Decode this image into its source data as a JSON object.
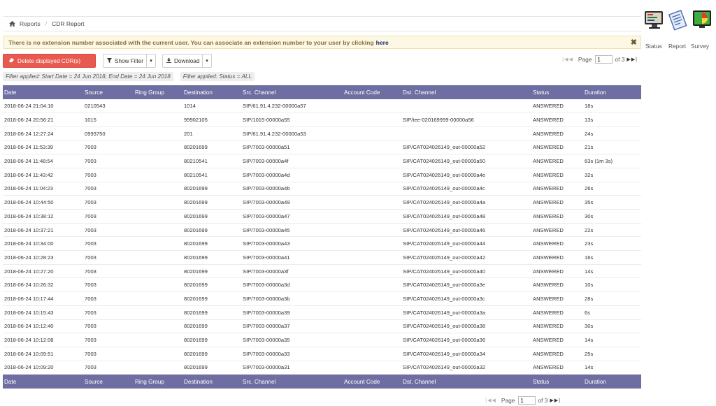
{
  "breadcrumb": {
    "items": [
      "Reports",
      "CDR Report"
    ]
  },
  "alert": {
    "message": "There is no extension number associated with the current user. You can associate an extension number to your user by clicking",
    "link": "here",
    "close": "✖"
  },
  "toolbar": {
    "delete_label": "Delete displayed CDR(s)",
    "filter_label": "Show Filter",
    "download_label": "Download"
  },
  "pagination": {
    "label": "Page",
    "current": "1",
    "of_label": "of 3"
  },
  "filters": [
    "Filter applied: Start Date = 24 Jun 2018, End Date = 24 Jun 2018",
    "Filter applied: Status = ALL"
  ],
  "table": {
    "columns": [
      "Date",
      "Source",
      "Ring Group",
      "Destination",
      "Src. Channel",
      "Account Code",
      "Dst. Channel",
      "Status",
      "Duration"
    ],
    "rows": [
      [
        "2018-06-24 21:04:10",
        "0210543",
        "",
        "1014",
        "SIP/61.91.4.232-00000a57",
        "",
        "",
        "ANSWERED",
        "18s"
      ],
      [
        "2018-06-24 20:56:21",
        "1015",
        "",
        "99902105",
        "SIP/1015-00000a55",
        "",
        "SIP/tee-020169999-00000a56",
        "ANSWERED",
        "13s"
      ],
      [
        "2018-06-24 12:27:24",
        "0993750",
        "",
        "201",
        "SIP/61.91.4.232-00000a53",
        "",
        "",
        "ANSWERED",
        "24s"
      ],
      [
        "2018-06-24 11:53:39",
        "7003",
        "",
        "80201699",
        "SIP/7003-00000a51",
        "",
        "SIP/CAT024026149_out-00000a52",
        "ANSWERED",
        "21s"
      ],
      [
        "2018-06-24 11:48:54",
        "7003",
        "",
        "80210541",
        "SIP/7003-00000a4f",
        "",
        "SIP/CAT024026149_out-00000a50",
        "ANSWERED",
        "63s (1m 3s)"
      ],
      [
        "2018-06-24 11:43:42",
        "7003",
        "",
        "80210541",
        "SIP/7003-00000a4d",
        "",
        "SIP/CAT024026149_out-00000a4e",
        "ANSWERED",
        "32s"
      ],
      [
        "2018-06-24 11:04:23",
        "7003",
        "",
        "80201699",
        "SIP/7003-00000a4b",
        "",
        "SIP/CAT024026149_out-00000a4c",
        "ANSWERED",
        "26s"
      ],
      [
        "2018-06-24 10:44:50",
        "7003",
        "",
        "80201699",
        "SIP/7003-00000a49",
        "",
        "SIP/CAT024026149_out-00000a4a",
        "ANSWERED",
        "35s"
      ],
      [
        "2018-06-24 10:38:12",
        "7003",
        "",
        "80201699",
        "SIP/7003-00000a47",
        "",
        "SIP/CAT024026149_out-00000a48",
        "ANSWERED",
        "30s"
      ],
      [
        "2018-06-24 10:37:21",
        "7003",
        "",
        "80201699",
        "SIP/7003-00000a45",
        "",
        "SIP/CAT024026149_out-00000a46",
        "ANSWERED",
        "22s"
      ],
      [
        "2018-06-24 10:34:00",
        "7003",
        "",
        "80201699",
        "SIP/7003-00000a43",
        "",
        "SIP/CAT024026149_out-00000a44",
        "ANSWERED",
        "23s"
      ],
      [
        "2018-06-24 10:28:23",
        "7003",
        "",
        "80201699",
        "SIP/7003-00000a41",
        "",
        "SIP/CAT024026149_out-00000a42",
        "ANSWERED",
        "16s"
      ],
      [
        "2018-06-24 10:27:20",
        "7003",
        "",
        "80201699",
        "SIP/7003-00000a3f",
        "",
        "SIP/CAT024026149_out-00000a40",
        "ANSWERED",
        "14s"
      ],
      [
        "2018-06-24 10:26:32",
        "7003",
        "",
        "80201699",
        "SIP/7003-00000a3d",
        "",
        "SIP/CAT024026149_out-00000a3e",
        "ANSWERED",
        "10s"
      ],
      [
        "2018-06-24 10:17:44",
        "7003",
        "",
        "80201699",
        "SIP/7003-00000a3b",
        "",
        "SIP/CAT024026149_out-00000a3c",
        "ANSWERED",
        "28s"
      ],
      [
        "2018-06-24 10:15:43",
        "7003",
        "",
        "80201699",
        "SIP/7003-00000a39",
        "",
        "SIP/CAT024026149_out-00000a3a",
        "ANSWERED",
        "6s"
      ],
      [
        "2018-06-24 10:12:40",
        "7003",
        "",
        "80201699",
        "SIP/7003-00000a37",
        "",
        "SIP/CAT024026149_out-00000a38",
        "ANSWERED",
        "30s"
      ],
      [
        "2018-06-24 10:12:08",
        "7003",
        "",
        "80201699",
        "SIP/7003-00000a35",
        "",
        "SIP/CAT024026149_out-00000a36",
        "ANSWERED",
        "14s"
      ],
      [
        "2018-06-24 10:09:51",
        "7003",
        "",
        "80201699",
        "SIP/7003-00000a33",
        "",
        "SIP/CAT024026149_out-00000a34",
        "ANSWERED",
        "25s"
      ],
      [
        "2018-06-24 10:09:20",
        "7003",
        "",
        "80201699",
        "SIP/7003-00000a31",
        "",
        "SIP/CAT024026149_out-00000a32",
        "ANSWERED",
        "14s"
      ]
    ]
  },
  "side_apps": [
    {
      "label": "Status",
      "icon": "monitor-status-icon"
    },
    {
      "label": "Report",
      "icon": "report-documents-icon"
    },
    {
      "label": "Survey",
      "icon": "survey-chart-icon"
    }
  ],
  "colors": {
    "table_header": "#6e6ea3",
    "delete_button": "#e85a50",
    "alert_bg": "#fcf8e3",
    "alert_text": "#8a6d3b"
  }
}
